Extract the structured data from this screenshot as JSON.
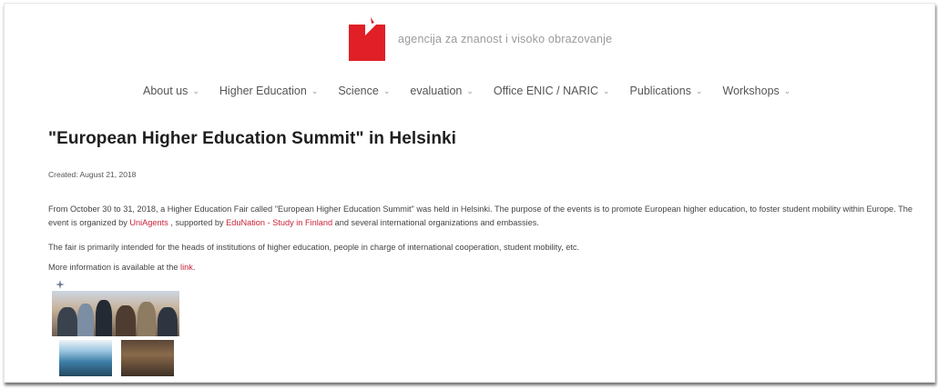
{
  "header": {
    "brand": "agencija za znanost i visoko obrazovanje",
    "logo_icon": "agency-logo-icon",
    "accent": "#e01f26"
  },
  "nav": {
    "items": [
      {
        "label": "About us"
      },
      {
        "label": "Higher Education"
      },
      {
        "label": "Science"
      },
      {
        "label": "evaluation"
      },
      {
        "label": "Office ENIC / NARIC"
      },
      {
        "label": "Publications"
      },
      {
        "label": "Workshops"
      }
    ],
    "chevron": "⌄"
  },
  "article": {
    "title": "\"European Higher Education Summit\" in Helsinki",
    "created": "Created: August 21, 2018",
    "p1_before": "From October 30 to 31, 2018, a Higher Education Fair called \"European Higher Education Summit\" was held in Helsinki. The purpose of the events is to promote European higher education, to foster student mobility within Europe. The event is organized by ",
    "link_uniagents": "UniAgents",
    "p1_mid": " , supported by ",
    "link_edunation": "EduNation - Study in Finland",
    "p1_after": " and several international organizations and embassies.",
    "p2": "The fair is primarily intended for the heads of institutions of higher education, people in charge of international cooperation, student mobility, etc.",
    "p3_before": "More information is available at the ",
    "link_more": "link",
    "p3_after": ".",
    "link_color": "#c8233a"
  }
}
